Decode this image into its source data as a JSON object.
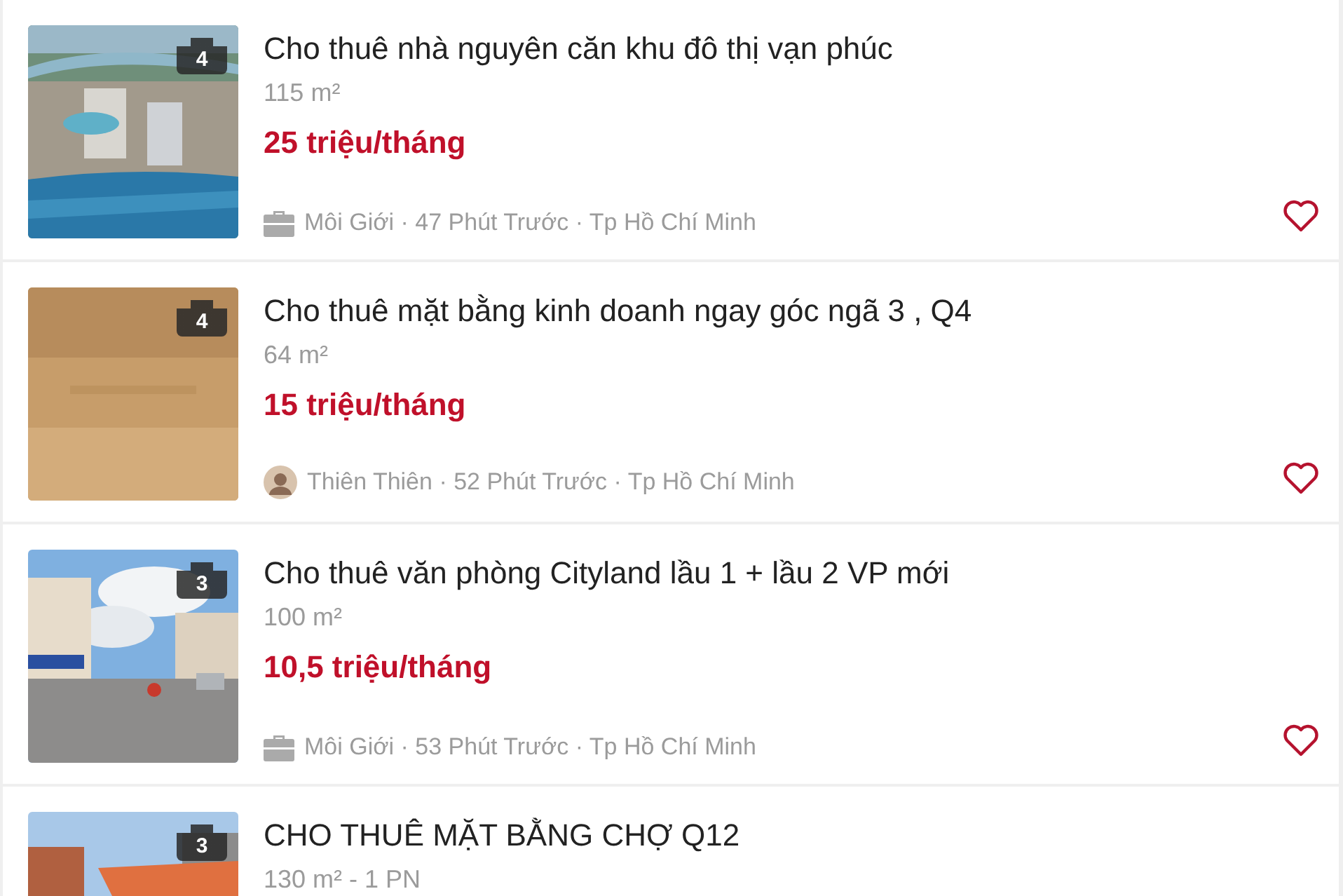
{
  "listings": [
    {
      "photo_count": "4",
      "title": "Cho thuê nhà nguyên căn khu đô thị vạn phúc",
      "area": "115 m²",
      "price": "25 triệu/tháng",
      "poster": {
        "kind": "broker"
      },
      "byline": "Môi Giới · 47 Phút Trước · Tp Hồ Chí Minh",
      "saved": false
    },
    {
      "photo_count": "4",
      "title": "Cho thuê mặt bằng kinh doanh ngay góc ngã 3 , Q4",
      "area": "64 m²",
      "price": "15 triệu/tháng",
      "poster": {
        "kind": "user"
      },
      "byline": "Thiên Thiên · 52 Phút Trước · Tp Hồ Chí Minh",
      "saved": false
    },
    {
      "photo_count": "3",
      "title": "Cho thuê văn phòng Cityland lầu 1 + lầu 2 VP mới",
      "area": "100 m²",
      "price": "10,5 triệu/tháng",
      "poster": {
        "kind": "broker"
      },
      "byline": "Môi Giới · 53 Phút Trước · Tp Hồ Chí Minh",
      "saved": false
    },
    {
      "photo_count": "3",
      "title": "CHO THUÊ MẶT BẰNG CHỢ Q12",
      "area": "130 m² - 1 PN"
    }
  ]
}
